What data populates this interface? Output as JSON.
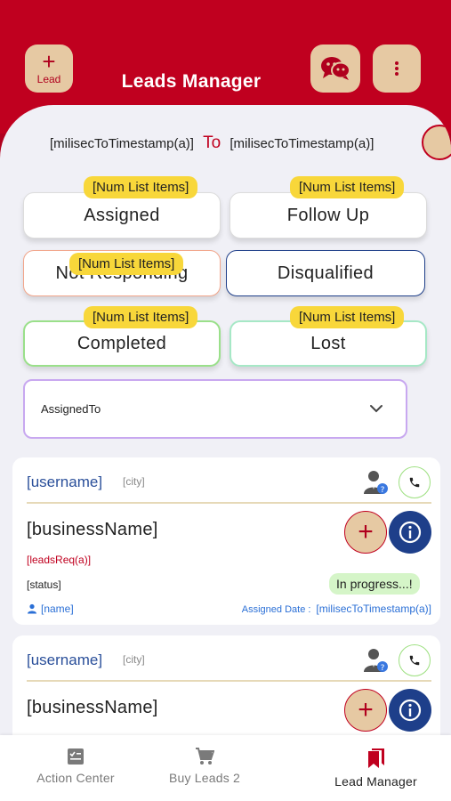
{
  "header": {
    "title": "Leads Manager",
    "lead_button": {
      "icon": "plus-icon",
      "label": "Lead"
    },
    "chat_icon": "chat-bubbles-icon",
    "menu_icon": "more-vertical-icon"
  },
  "date_range": {
    "from": "[milisecToTimestamp(a)]",
    "separator": "To",
    "to": "[milisecToTimestamp(a)]"
  },
  "status_cards": [
    {
      "label": "Assigned",
      "count": "[Num List Items]"
    },
    {
      "label": "Follow Up",
      "count": "[Num List Items]"
    },
    {
      "label": "Not Responding",
      "count": "[Num List Items]"
    },
    {
      "label": "Disqualified"
    },
    {
      "label": "Completed",
      "count": "[Num List Items]"
    },
    {
      "label": "Lost",
      "count": "[Num List Items]"
    }
  ],
  "assigned_dropdown": {
    "label": "AssignedTo"
  },
  "leads": [
    {
      "username": "[username]",
      "city": "[city]",
      "business_name": "[businessName]",
      "leads_req": "[leadsReq(a)]",
      "status": "[status]",
      "progress": "In progress...!",
      "name": "[name]",
      "assigned_date_label": "Assigned Date :",
      "assigned_date": "[milisecToTimestamp(a)]"
    },
    {
      "username": "[username]",
      "city": "[city]",
      "business_name": "[businessName]"
    }
  ],
  "bottom_nav": [
    {
      "label": "Action Center",
      "icon": "checklist-icon"
    },
    {
      "label": "Buy Leads 2",
      "icon": "cart-icon"
    },
    {
      "label": "Lead Manager",
      "icon": "bookmarks-icon"
    }
  ],
  "colors": {
    "brand_red": "#c0001f",
    "tan": "#e6c9a3",
    "navy": "#1e3f8a",
    "badge_yellow": "#f8d73a"
  }
}
